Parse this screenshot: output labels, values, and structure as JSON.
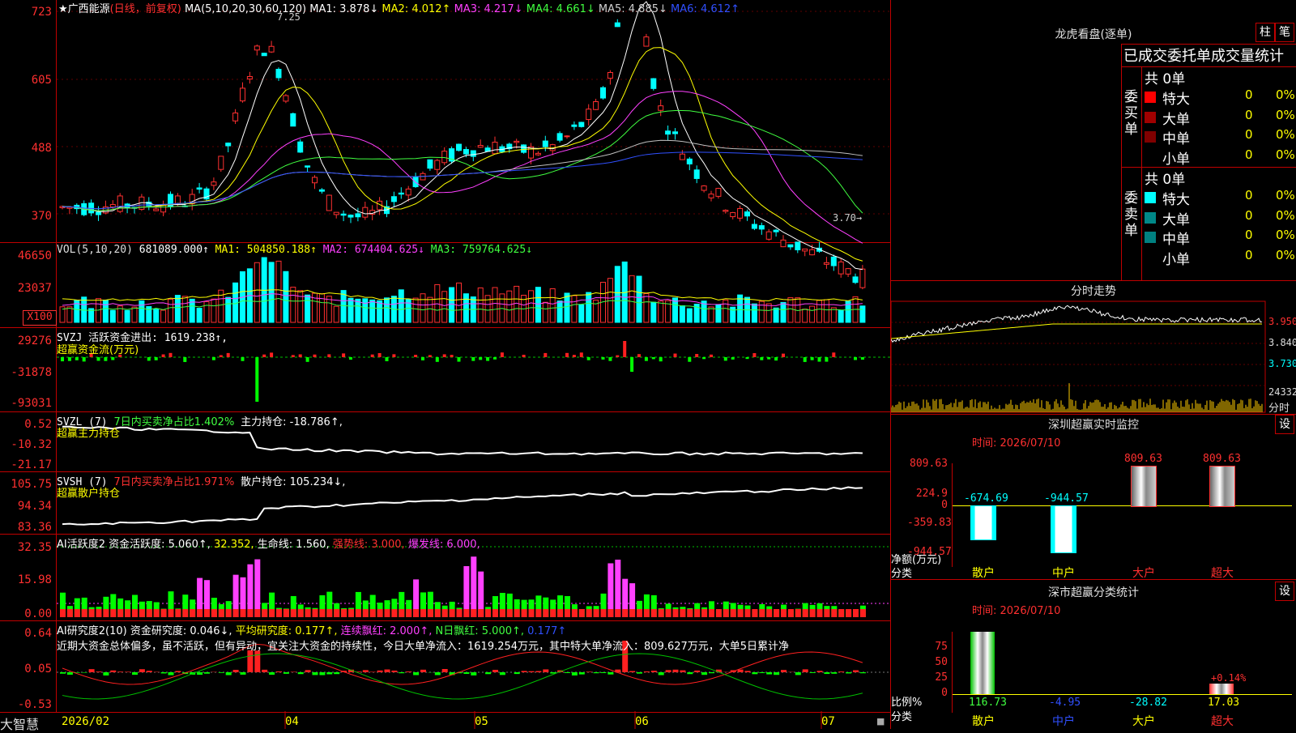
{
  "app": {
    "name": "大智慧"
  },
  "kline": {
    "title": "★广西能源",
    "subtitle": "(日线，前复权)",
    "ma_label": "MA(5,10,20,30,60,120)",
    "ma1": "MA1: 3.878↓",
    "ma2": "MA2: 4.012↑",
    "ma3": "MA3: 4.217↓",
    "ma4": "MA4: 4.661↓",
    "ma5": "MA5: 4.885↓",
    "ma6": "MA6: 4.612↑",
    "high_mark": "7.25",
    "low_mark": "3.70→",
    "y_ticks": [
      "723",
      "605",
      "488",
      "370"
    ]
  },
  "vol": {
    "label": "VOL(5,10,20)",
    "value": "681089.000↑",
    "ma1": "MA1: 504850.188↑",
    "ma2": "MA2: 674404.625↓",
    "ma3": "MA3: 759764.625↓",
    "y_ticks": [
      "46650",
      "23037",
      "X100"
    ]
  },
  "svzj": {
    "label": "SVZJ  活跃资金进出: 1619.238↑,",
    "sub": "超赢资金流(万元)",
    "y_ticks": [
      "29276",
      "-31878",
      "-93031"
    ]
  },
  "svzl": {
    "label": "SVZL (7)",
    "ratio": "7日内买卖净占比1.402%",
    "hold": "主力持仓: -18.786↑,",
    "sub": "超赢主力持仓",
    "y_ticks": [
      "0.52",
      "-10.32",
      "-21.17"
    ]
  },
  "svsh": {
    "label": "SVSH (7)",
    "ratio": "7日内买卖净占比1.971%",
    "hold": "散户持仓: 105.234↓,",
    "sub": "超赢散户持仓",
    "y_ticks": [
      "105.75",
      "94.34",
      "83.36"
    ]
  },
  "ai_active": {
    "label": "AI活跃度2 资金活跃度: 5.060↑,",
    "v2": "32.352,",
    "v3": "生命线: 1.560,",
    "v4": "强势线: 3.000,",
    "v5": "爆发线: 6.000,",
    "y_ticks": [
      "32.35",
      "15.98",
      "0.00"
    ]
  },
  "ai_research": {
    "label": "AI研究度2(10) 资金研究度: 0.046↓,",
    "v2": "平均研究度: 0.177↑,",
    "v3": "连续飘红: 2.000↑,",
    "v4": "N日飘红: 5.000↑,",
    "v5": "0.177↑",
    "comment": "近期大资金总体偏多，虽不活跃，但有异动，宜关注大资金的持续性，今日大单净流入：1619.254万元，其中特大单净流入：809.627万元，大单5日累计净",
    "y_ticks": [
      "0.64",
      "0.05",
      "-0.53"
    ]
  },
  "xaxis": {
    "labels": [
      "2026/02",
      "04",
      "05",
      "06",
      "07"
    ]
  },
  "dragon": {
    "title": "龙虎看盘(逐单)",
    "btn1": "柱",
    "btn2": "笔",
    "header": "已成交委托单成交量统计",
    "buy_label": "委买单",
    "sell_label": "委卖单",
    "buy_total": "共 0单",
    "sell_total": "共 0单",
    "rows": [
      "特大",
      "大单",
      "中单",
      "小单"
    ],
    "zero": "0",
    "pct": "0%",
    "buy_colors": [
      "#ff0000",
      "#a00000",
      "#800000",
      "#000000"
    ],
    "sell_colors": [
      "#00ffff",
      "#008888",
      "#008080",
      "#000000"
    ]
  },
  "intraday": {
    "title": "分时走势",
    "prices": [
      "3.950",
      "3.840",
      "3.730"
    ],
    "vol_top": "24332",
    "vol_label": "分时"
  },
  "sz_monitor": {
    "title": "深圳超赢实时监控",
    "btn": "设",
    "time": "时间: 2026/07/10",
    "y_ticks": [
      "809.63",
      "224.9",
      "0",
      "-359.83",
      "-944.57"
    ],
    "bars": [
      {
        "label": "散户",
        "value": -674.69,
        "text": "-674.69"
      },
      {
        "label": "中户",
        "value": -944.57,
        "text": "-944.57"
      },
      {
        "label": "大户",
        "value": 809.63,
        "text": "809.63"
      },
      {
        "label": "超大",
        "value": 809.63,
        "text": "809.63"
      }
    ],
    "axis_label1": "净额(万元)",
    "axis_label2": "分类"
  },
  "sz_class": {
    "title": "深市超赢分类统计",
    "btn": "设",
    "time": "时间: 2026/07/10",
    "y_ticks": [
      "75",
      "50",
      "25",
      "0"
    ],
    "bars": [
      {
        "label": "散户",
        "value": 116.73,
        "text": "116.73"
      },
      {
        "label": "中户",
        "value": -4.95,
        "text": "-4.95"
      },
      {
        "label": "大户",
        "value": -28.82,
        "text": "-28.82"
      },
      {
        "label": "超大",
        "value": 17.03,
        "text": "17.03",
        "note": "+0.14%"
      }
    ],
    "axis_label1": "比例%",
    "axis_label2": "分类"
  }
}
